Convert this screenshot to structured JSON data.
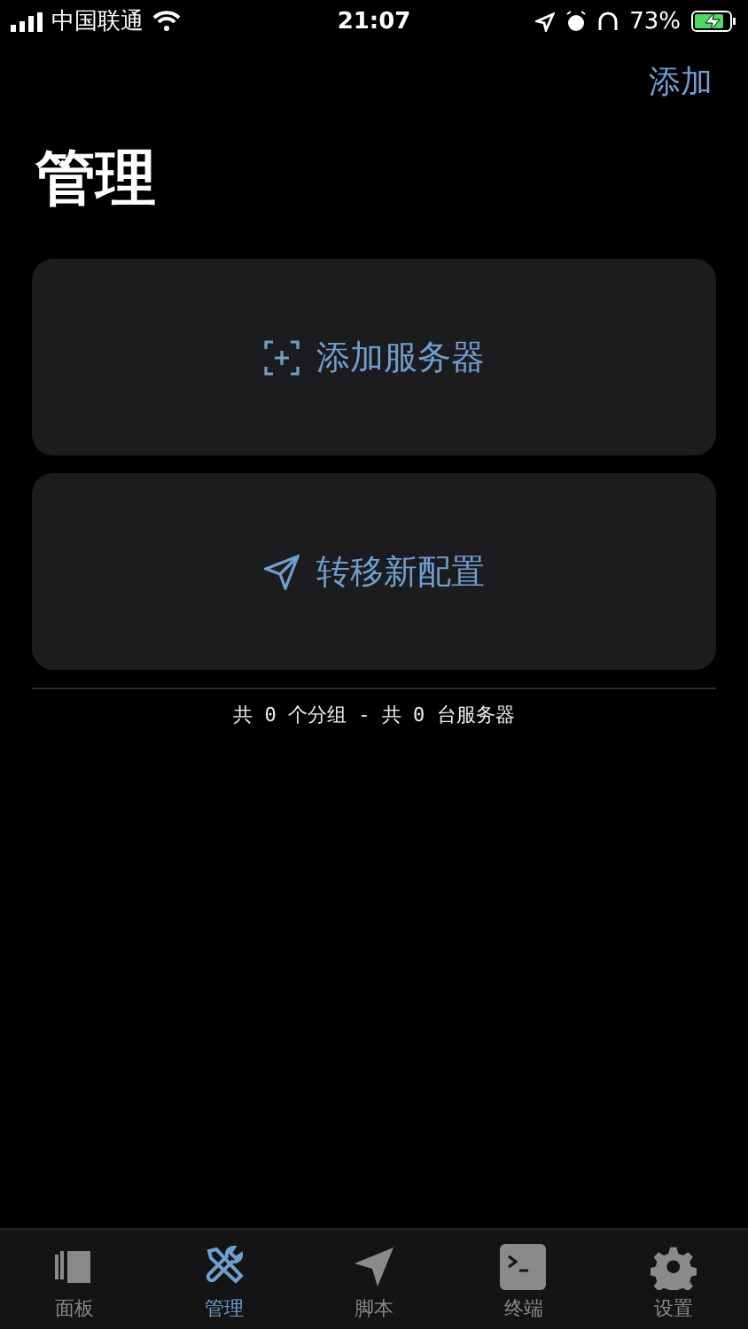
{
  "status_bar": {
    "carrier": "中国联通",
    "time": "21:07",
    "battery": "73%"
  },
  "nav": {
    "action": "添加",
    "title": "管理"
  },
  "actions": [
    {
      "kind": "add",
      "label": "添加服务器"
    },
    {
      "kind": "send",
      "label": "转移新配置"
    }
  ],
  "summary": "共 0 个分组 - 共 0 台服务器",
  "tabs": [
    {
      "kind": "panels",
      "label": "面板",
      "selected": false
    },
    {
      "kind": "tools",
      "label": "管理",
      "selected": true
    },
    {
      "kind": "send",
      "label": "脚本",
      "selected": false
    },
    {
      "kind": "terminal",
      "label": "终端",
      "selected": false
    },
    {
      "kind": "gear",
      "label": "设置",
      "selected": false
    }
  ]
}
